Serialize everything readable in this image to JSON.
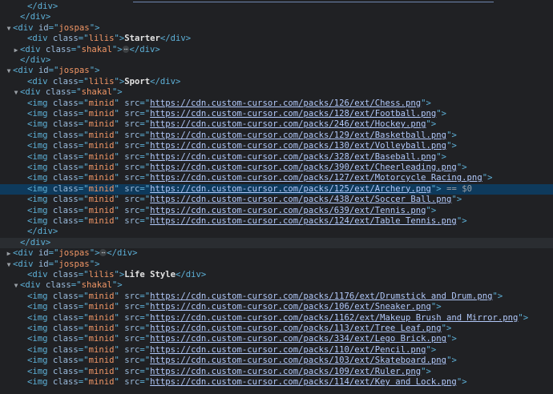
{
  "top_cut_url": "https://cdn.custom-cursor.com/packs/...",
  "rows": [
    {
      "t": "close",
      "text": "</div>",
      "ind": 2
    },
    {
      "t": "close",
      "text": "</div>",
      "ind": 1
    },
    {
      "t": "open",
      "arrow": "▼",
      "tag": "div",
      "attr": "id",
      "val": "jospas",
      "ind": 0
    },
    {
      "t": "text",
      "tag": "div",
      "attr": "class",
      "val": "lilis",
      "content": "Starter",
      "ind": 2
    },
    {
      "t": "collapsed",
      "arrow": "▶",
      "tag": "div",
      "attr": "class",
      "val": "shakal",
      "ellipsis": "⋯",
      "ind": 1
    },
    {
      "t": "close",
      "text": "</div>",
      "ind": 1
    },
    {
      "t": "open",
      "arrow": "▼",
      "tag": "div",
      "attr": "id",
      "val": "jospas",
      "ind": 0
    },
    {
      "t": "text",
      "tag": "div",
      "attr": "class",
      "val": "lilis",
      "content": "Sport",
      "ind": 2
    },
    {
      "t": "open",
      "arrow": "▼",
      "tag": "div",
      "attr": "class",
      "val": "shakal",
      "ind": 1
    },
    {
      "t": "img",
      "val": "minid",
      "src": "https://cdn.custom-cursor.com/packs/126/ext/Chess.png",
      "ind": 3
    },
    {
      "t": "img",
      "val": "minid",
      "src": "https://cdn.custom-cursor.com/packs/128/ext/Football.png",
      "ind": 3
    },
    {
      "t": "img",
      "val": "minid",
      "src": "https://cdn.custom-cursor.com/packs/246/ext/Hockey.png",
      "ind": 3
    },
    {
      "t": "img",
      "val": "minid",
      "src": "https://cdn.custom-cursor.com/packs/129/ext/Basketball.png",
      "ind": 3
    },
    {
      "t": "img",
      "val": "minid",
      "src": "https://cdn.custom-cursor.com/packs/130/ext/Volleyball.png",
      "ind": 3
    },
    {
      "t": "img",
      "val": "minid",
      "src": "https://cdn.custom-cursor.com/packs/328/ext/Baseball.png",
      "ind": 3
    },
    {
      "t": "img",
      "val": "minid",
      "src": "https://cdn.custom-cursor.com/packs/390/ext/Cheerleading.png",
      "ind": 3
    },
    {
      "t": "img",
      "val": "minid",
      "src": "https://cdn.custom-cursor.com/packs/127/ext/Motorcycle Racing.png",
      "ind": 3
    },
    {
      "t": "img",
      "val": "minid",
      "src": "https://cdn.custom-cursor.com/packs/125/ext/Archery.png",
      "ind": 3,
      "selected": true,
      "suffix": " == $0"
    },
    {
      "t": "img",
      "val": "minid",
      "src": "https://cdn.custom-cursor.com/packs/438/ext/Soccer Ball.png",
      "ind": 3
    },
    {
      "t": "img",
      "val": "minid",
      "src": "https://cdn.custom-cursor.com/packs/639/ext/Tennis.png",
      "ind": 3
    },
    {
      "t": "img",
      "val": "minid",
      "src": "https://cdn.custom-cursor.com/packs/124/ext/Table Tennis.png",
      "ind": 3
    },
    {
      "t": "close",
      "text": "</div>",
      "ind": 2
    },
    {
      "t": "close",
      "text": "</div>",
      "ind": 1,
      "hover": true
    },
    {
      "t": "collapsed",
      "arrow": "▶",
      "tag": "div",
      "attr": "id",
      "val": "jospas",
      "ellipsis": "⋯",
      "ind": 0
    },
    {
      "t": "open",
      "arrow": "▼",
      "tag": "div",
      "attr": "id",
      "val": "jospas",
      "ind": 0
    },
    {
      "t": "text",
      "tag": "div",
      "attr": "class",
      "val": "lilis",
      "content": "Life Style",
      "ind": 2
    },
    {
      "t": "open",
      "arrow": "▼",
      "tag": "div",
      "attr": "class",
      "val": "shakal",
      "ind": 1
    },
    {
      "t": "img",
      "val": "minid",
      "src": "https://cdn.custom-cursor.com/packs/1176/ext/Drumstick and Drum.png",
      "ind": 3
    },
    {
      "t": "img",
      "val": "minid",
      "src": "https://cdn.custom-cursor.com/packs/106/ext/Sneaker.png",
      "ind": 3
    },
    {
      "t": "img",
      "val": "minid",
      "src": "https://cdn.custom-cursor.com/packs/1162/ext/Makeup Brush and Mirror.png",
      "ind": 3
    },
    {
      "t": "img",
      "val": "minid",
      "src": "https://cdn.custom-cursor.com/packs/113/ext/Tree Leaf.png",
      "ind": 3
    },
    {
      "t": "img",
      "val": "minid",
      "src": "https://cdn.custom-cursor.com/packs/334/ext/Lego Brick.png",
      "ind": 3
    },
    {
      "t": "img",
      "val": "minid",
      "src": "https://cdn.custom-cursor.com/packs/110/ext/Pencil.png",
      "ind": 3
    },
    {
      "t": "img",
      "val": "minid",
      "src": "https://cdn.custom-cursor.com/packs/103/ext/Skateboard.png",
      "ind": 3
    },
    {
      "t": "img",
      "val": "minid",
      "src": "https://cdn.custom-cursor.com/packs/109/ext/Ruler.png",
      "ind": 3
    },
    {
      "t": "img",
      "val": "minid",
      "src": "https://cdn.custom-cursor.com/packs/114/ext/Key and Lock.png",
      "ind": 3
    }
  ]
}
